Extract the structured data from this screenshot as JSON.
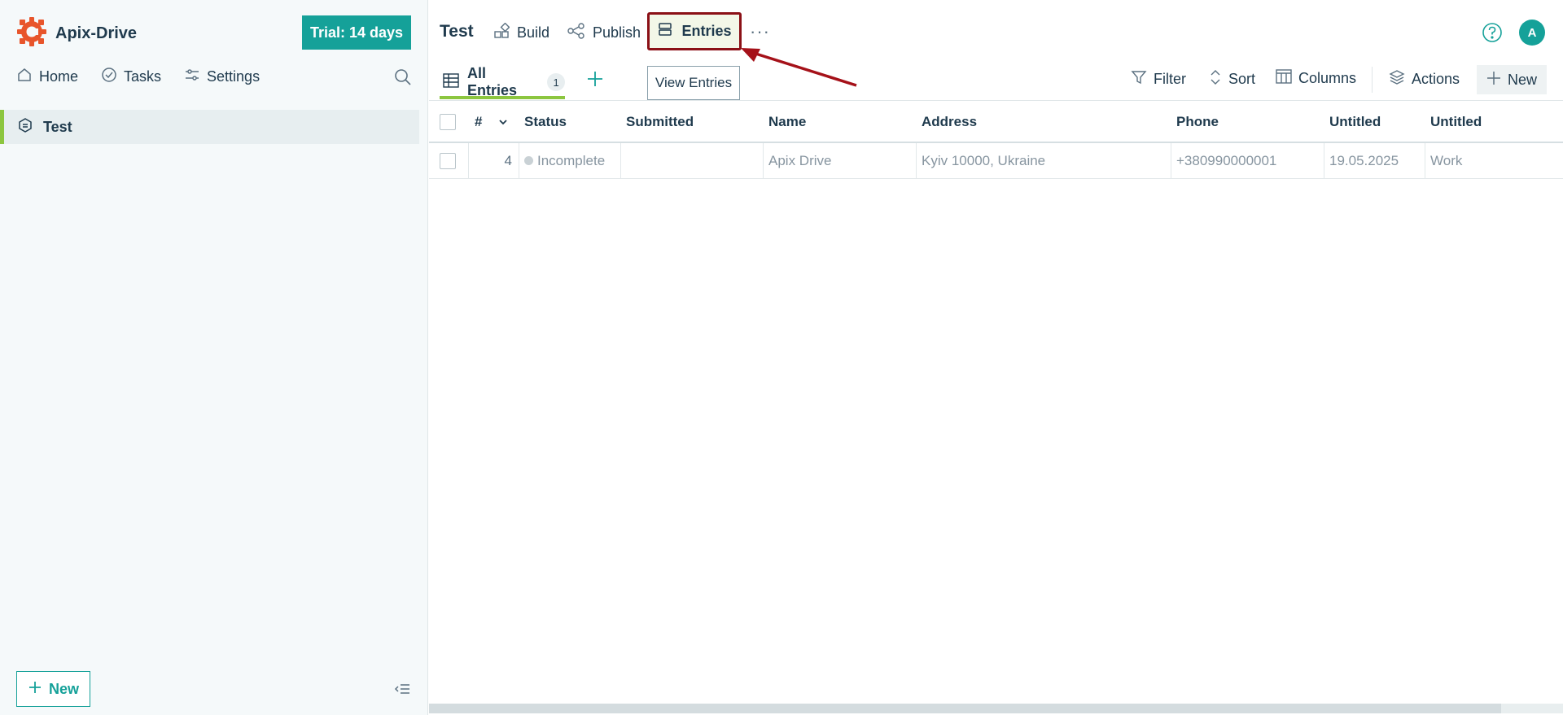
{
  "brand": {
    "name": "Apix-Drive",
    "logo_icon": "gear-logo-icon",
    "accent": "#e8552b"
  },
  "trial": {
    "label": "Trial: 14 days",
    "color": "#15a199"
  },
  "sidebar": {
    "nav": [
      {
        "label": "Home",
        "icon": "home-icon"
      },
      {
        "label": "Tasks",
        "icon": "check-circle-icon"
      },
      {
        "label": "Settings",
        "icon": "sliders-icon"
      }
    ],
    "forms": [
      {
        "label": "Test",
        "icon": "form-icon",
        "active": true
      }
    ],
    "new_label": "New"
  },
  "header": {
    "title": "Test",
    "tabs": [
      {
        "label": "Build",
        "icon": "build-icon"
      },
      {
        "label": "Publish",
        "icon": "share-icon"
      },
      {
        "label": "Entries",
        "icon": "entries-icon",
        "highlighted": true
      }
    ],
    "more": "···",
    "avatar": "A"
  },
  "tooltip": {
    "text": "View Entries"
  },
  "view": {
    "label": "All Entries",
    "count": "1"
  },
  "toolbar": {
    "filter": "Filter",
    "sort": "Sort",
    "columns": "Columns",
    "actions": "Actions",
    "new": "New"
  },
  "table": {
    "columns": [
      "#",
      "Status",
      "Submitted",
      "Name",
      "Address",
      "Phone",
      "Untitled",
      "Untitled"
    ],
    "rows": [
      {
        "num": "4",
        "status": "Incomplete",
        "submitted": "",
        "name": "Apix Drive",
        "address": "Kyiv 10000, Ukraine",
        "phone": "+380990000001",
        "untitled1": "19.05.2025",
        "untitled2": "Work"
      }
    ]
  },
  "annotation": {
    "border_color": "#8b1016"
  }
}
